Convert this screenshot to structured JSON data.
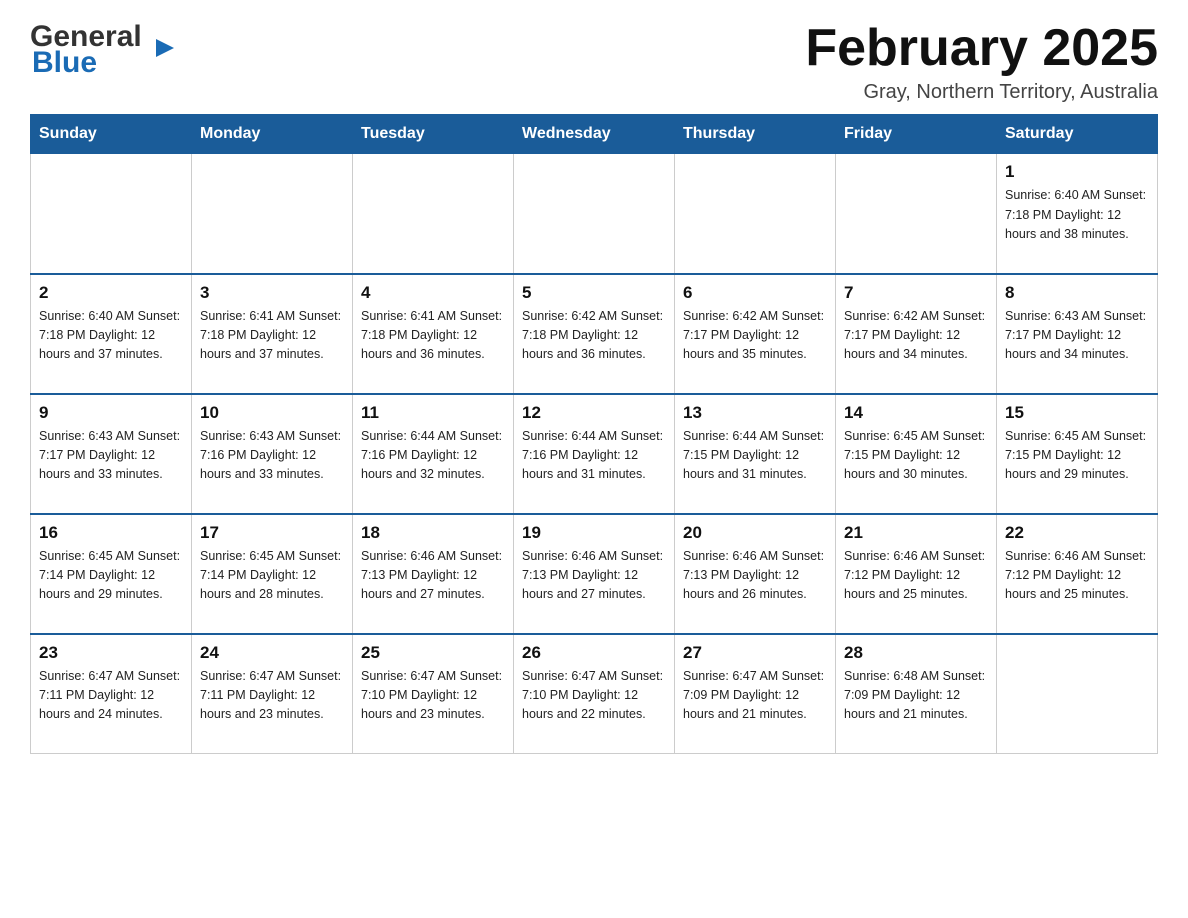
{
  "header": {
    "logo_general": "General",
    "logo_blue": "Blue",
    "title": "February 2025",
    "subtitle": "Gray, Northern Territory, Australia"
  },
  "days_of_week": [
    "Sunday",
    "Monday",
    "Tuesday",
    "Wednesday",
    "Thursday",
    "Friday",
    "Saturday"
  ],
  "weeks": [
    [
      {
        "day": "",
        "info": ""
      },
      {
        "day": "",
        "info": ""
      },
      {
        "day": "",
        "info": ""
      },
      {
        "day": "",
        "info": ""
      },
      {
        "day": "",
        "info": ""
      },
      {
        "day": "",
        "info": ""
      },
      {
        "day": "1",
        "info": "Sunrise: 6:40 AM\nSunset: 7:18 PM\nDaylight: 12 hours and 38 minutes."
      }
    ],
    [
      {
        "day": "2",
        "info": "Sunrise: 6:40 AM\nSunset: 7:18 PM\nDaylight: 12 hours and 37 minutes."
      },
      {
        "day": "3",
        "info": "Sunrise: 6:41 AM\nSunset: 7:18 PM\nDaylight: 12 hours and 37 minutes."
      },
      {
        "day": "4",
        "info": "Sunrise: 6:41 AM\nSunset: 7:18 PM\nDaylight: 12 hours and 36 minutes."
      },
      {
        "day": "5",
        "info": "Sunrise: 6:42 AM\nSunset: 7:18 PM\nDaylight: 12 hours and 36 minutes."
      },
      {
        "day": "6",
        "info": "Sunrise: 6:42 AM\nSunset: 7:17 PM\nDaylight: 12 hours and 35 minutes."
      },
      {
        "day": "7",
        "info": "Sunrise: 6:42 AM\nSunset: 7:17 PM\nDaylight: 12 hours and 34 minutes."
      },
      {
        "day": "8",
        "info": "Sunrise: 6:43 AM\nSunset: 7:17 PM\nDaylight: 12 hours and 34 minutes."
      }
    ],
    [
      {
        "day": "9",
        "info": "Sunrise: 6:43 AM\nSunset: 7:17 PM\nDaylight: 12 hours and 33 minutes."
      },
      {
        "day": "10",
        "info": "Sunrise: 6:43 AM\nSunset: 7:16 PM\nDaylight: 12 hours and 33 minutes."
      },
      {
        "day": "11",
        "info": "Sunrise: 6:44 AM\nSunset: 7:16 PM\nDaylight: 12 hours and 32 minutes."
      },
      {
        "day": "12",
        "info": "Sunrise: 6:44 AM\nSunset: 7:16 PM\nDaylight: 12 hours and 31 minutes."
      },
      {
        "day": "13",
        "info": "Sunrise: 6:44 AM\nSunset: 7:15 PM\nDaylight: 12 hours and 31 minutes."
      },
      {
        "day": "14",
        "info": "Sunrise: 6:45 AM\nSunset: 7:15 PM\nDaylight: 12 hours and 30 minutes."
      },
      {
        "day": "15",
        "info": "Sunrise: 6:45 AM\nSunset: 7:15 PM\nDaylight: 12 hours and 29 minutes."
      }
    ],
    [
      {
        "day": "16",
        "info": "Sunrise: 6:45 AM\nSunset: 7:14 PM\nDaylight: 12 hours and 29 minutes."
      },
      {
        "day": "17",
        "info": "Sunrise: 6:45 AM\nSunset: 7:14 PM\nDaylight: 12 hours and 28 minutes."
      },
      {
        "day": "18",
        "info": "Sunrise: 6:46 AM\nSunset: 7:13 PM\nDaylight: 12 hours and 27 minutes."
      },
      {
        "day": "19",
        "info": "Sunrise: 6:46 AM\nSunset: 7:13 PM\nDaylight: 12 hours and 27 minutes."
      },
      {
        "day": "20",
        "info": "Sunrise: 6:46 AM\nSunset: 7:13 PM\nDaylight: 12 hours and 26 minutes."
      },
      {
        "day": "21",
        "info": "Sunrise: 6:46 AM\nSunset: 7:12 PM\nDaylight: 12 hours and 25 minutes."
      },
      {
        "day": "22",
        "info": "Sunrise: 6:46 AM\nSunset: 7:12 PM\nDaylight: 12 hours and 25 minutes."
      }
    ],
    [
      {
        "day": "23",
        "info": "Sunrise: 6:47 AM\nSunset: 7:11 PM\nDaylight: 12 hours and 24 minutes."
      },
      {
        "day": "24",
        "info": "Sunrise: 6:47 AM\nSunset: 7:11 PM\nDaylight: 12 hours and 23 minutes."
      },
      {
        "day": "25",
        "info": "Sunrise: 6:47 AM\nSunset: 7:10 PM\nDaylight: 12 hours and 23 minutes."
      },
      {
        "day": "26",
        "info": "Sunrise: 6:47 AM\nSunset: 7:10 PM\nDaylight: 12 hours and 22 minutes."
      },
      {
        "day": "27",
        "info": "Sunrise: 6:47 AM\nSunset: 7:09 PM\nDaylight: 12 hours and 21 minutes."
      },
      {
        "day": "28",
        "info": "Sunrise: 6:48 AM\nSunset: 7:09 PM\nDaylight: 12 hours and 21 minutes."
      },
      {
        "day": "",
        "info": ""
      }
    ]
  ]
}
